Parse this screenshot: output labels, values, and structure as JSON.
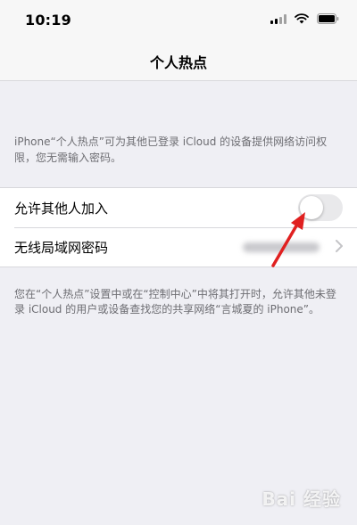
{
  "status_bar": {
    "time": "10:19",
    "icons": [
      "signal-icon",
      "wifi-icon",
      "battery-icon"
    ]
  },
  "nav": {
    "title": "个人热点"
  },
  "header_note": "iPhone“个人热点”可为其他已登录 iCloud 的设备提供网络访问权限，您无需输入密码。",
  "settings": {
    "allow_others": {
      "label": "允许其他人加入",
      "enabled": false
    },
    "wifi_password": {
      "label": "无线局域网密码",
      "icon": "chevron-right-icon"
    }
  },
  "footer_note": "您在“个人热点”设置中或在“控制中心”中将其打开时，允许其他未登录 iCloud 的用户或设备查找您的共享网络“言城夏的 iPhone”。",
  "watermark": "Bai 经验",
  "colors": {
    "background": "#efeff4",
    "annotation": "#e02020",
    "toggle_off": "#e9e9eb",
    "note_text": "#6d6d72"
  }
}
